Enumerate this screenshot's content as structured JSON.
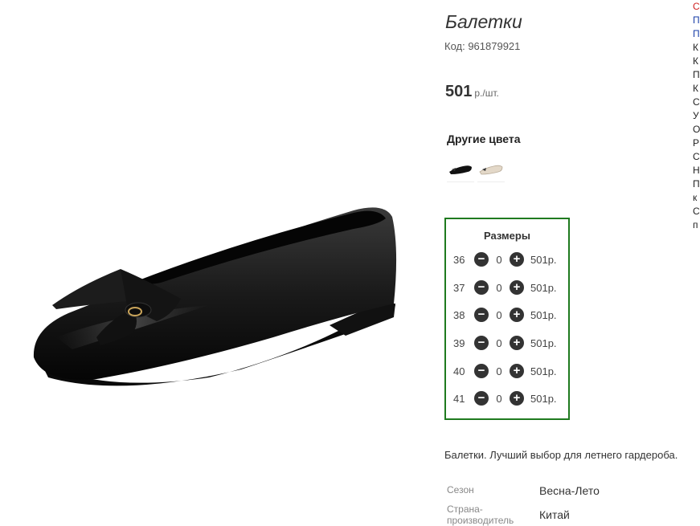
{
  "product": {
    "title": "Балетки",
    "code": "Код: 961879921",
    "price": "501",
    "price_unit": "р./шт.",
    "other_colors_heading": "Другие цвета",
    "other_colors": [
      {
        "name": "black-flat-thumbnail"
      },
      {
        "name": "beige-flat-thumbnail"
      }
    ]
  },
  "sizes": {
    "heading": "Размеры",
    "rows": [
      {
        "size": "36",
        "qty": "0",
        "price": "501р."
      },
      {
        "size": "37",
        "qty": "0",
        "price": "501р."
      },
      {
        "size": "38",
        "qty": "0",
        "price": "501р."
      },
      {
        "size": "39",
        "qty": "0",
        "price": "501р."
      },
      {
        "size": "40",
        "qty": "0",
        "price": "501р."
      },
      {
        "size": "41",
        "qty": "0",
        "price": "501р."
      }
    ]
  },
  "description": "Балетки. Лучший выбор для летнего гардероба.",
  "specs": [
    {
      "label": "Сезон",
      "value": "Весна-Лето"
    },
    {
      "label": "Страна-\nпроизводитель",
      "value": "Китай"
    }
  ],
  "side_links": [
    "С",
    "П",
    "П",
    "К",
    "К",
    "П",
    "К",
    "С",
    "У",
    "О",
    "Р",
    "С",
    "Н",
    "П",
    "к",
    "С",
    "п"
  ],
  "colors": {
    "size_box_border": "#1f7a1f",
    "link_red": "#d02020",
    "link_blue": "#1a3fa8"
  }
}
